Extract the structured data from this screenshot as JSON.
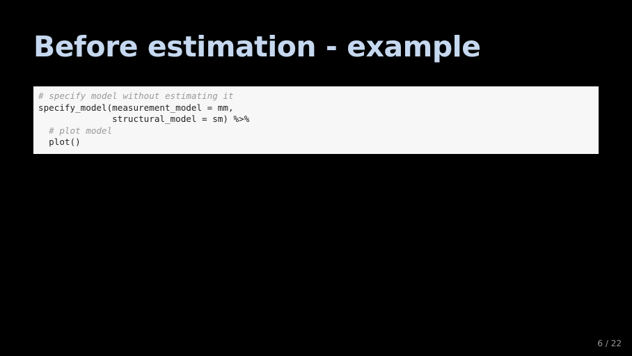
{
  "slide": {
    "title": "Before estimation - example",
    "code": {
      "lines": [
        {
          "indent": "",
          "text": "# specify model without estimating it",
          "type": "comment"
        },
        {
          "indent": "",
          "text": "specify_model(measurement_model = mm,",
          "type": "code"
        },
        {
          "indent": "              ",
          "text": "structural_model = sm) %>%",
          "type": "code"
        },
        {
          "indent": "  ",
          "text": "# plot model",
          "type": "comment"
        },
        {
          "indent": "  ",
          "text": "plot()",
          "type": "code"
        }
      ]
    },
    "slide_number": "6 / 22"
  },
  "colors": {
    "background": "#000000",
    "title": "#c5d8ef",
    "code_background": "#f7f7f7",
    "code_text": "#222222",
    "comment_text": "#9a9a9a"
  }
}
